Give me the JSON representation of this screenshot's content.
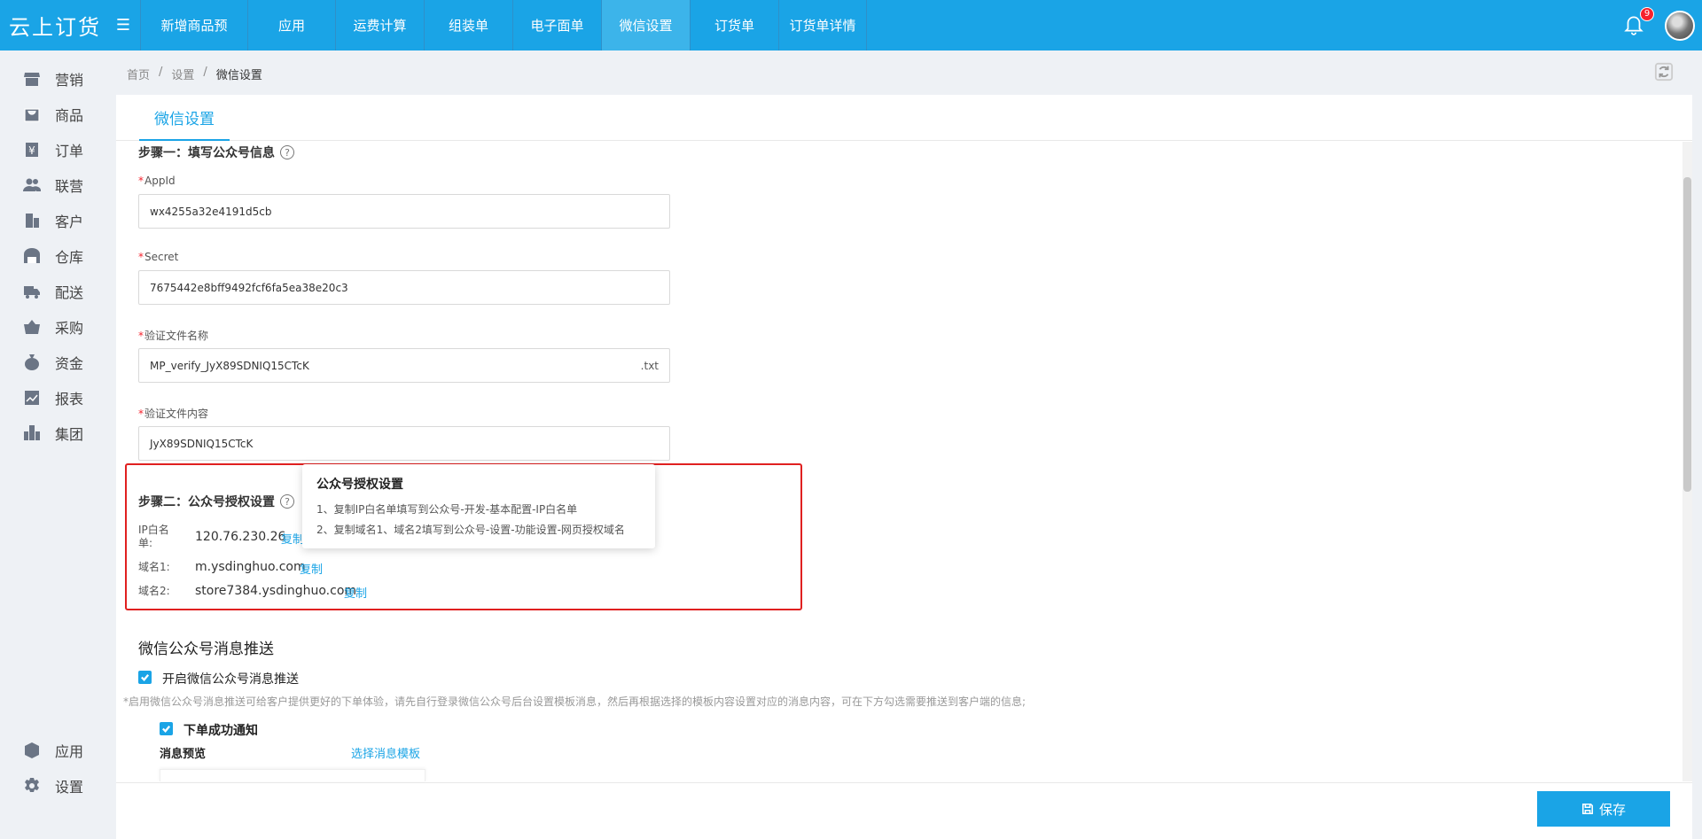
{
  "app": {
    "logo_text": "云上订货"
  },
  "nav": {
    "tabs": [
      {
        "label": "新增商品预"
      },
      {
        "label": "应用"
      },
      {
        "label": "运费计算"
      },
      {
        "label": "组装单"
      },
      {
        "label": "电子面单"
      },
      {
        "label": "微信设置",
        "active": true
      },
      {
        "label": "订货单"
      },
      {
        "label": "订货单详情"
      }
    ],
    "notifications": "9"
  },
  "sidebar": {
    "items": [
      {
        "label": "营销",
        "icon": "store-icon"
      },
      {
        "label": "商品",
        "icon": "bag-icon"
      },
      {
        "label": "订单",
        "icon": "yen-icon"
      },
      {
        "label": "联营",
        "icon": "people-icon"
      },
      {
        "label": "客户",
        "icon": "building-icon"
      },
      {
        "label": "仓库",
        "icon": "warehouse-icon"
      },
      {
        "label": "配送",
        "icon": "truck-icon"
      },
      {
        "label": "采购",
        "icon": "basket-icon"
      },
      {
        "label": "资金",
        "icon": "money-bag-icon"
      },
      {
        "label": "报表",
        "icon": "chart-icon"
      },
      {
        "label": "集团",
        "icon": "group-icon"
      }
    ],
    "bottom": [
      {
        "label": "应用",
        "icon": "cube-icon"
      },
      {
        "label": "设置",
        "icon": "gear-icon"
      }
    ]
  },
  "breadcrumb": {
    "home": "首页",
    "sep": "/",
    "level1": "设置",
    "current": "微信设置"
  },
  "page": {
    "tab": "微信设置",
    "step1": {
      "title": "步骤一：填写公众号信息",
      "fields": [
        {
          "label": "AppId",
          "value": "wx4255a32e4191d5cb"
        },
        {
          "label": "Secret",
          "value": "7675442e8bff9492fcf6fa5ea38e20c3"
        },
        {
          "label": "验证文件名称",
          "value": "MP_verify_JyX89SDNIQ15CTcK",
          "suffix": ".txt"
        },
        {
          "label": "验证文件内容",
          "value": "JyX89SDNIQ15CTcK"
        }
      ],
      "required_mark": "*"
    },
    "step2": {
      "title": "步骤二：公众号授权设置",
      "ip_label": "IP白名单:",
      "ip_value": "120.76.230.26",
      "domain1_label": "域名1:",
      "domain1_value": "m.ysdinghuo.com",
      "domain2_label": "域名2:",
      "domain2_value": "store7384.ysdinghuo.com",
      "copy_label": "复制"
    },
    "tooltip": {
      "title": "公众号授权设置",
      "line1": "1、复制IP白名单填写到公众号-开发-基本配置-IP白名单",
      "line2": "2、复制域名1、域名2填写到公众号-设置-功能设置-网页授权域名"
    },
    "push": {
      "title": "微信公众号消息推送",
      "enable_label": "开启微信公众号消息推送",
      "hint": "*启用微信公众号消息推送可给客户提供更好的下单体验，请先自行登录微信公众号后台设置模板消息，然后再根据选择的模板内容设置对应的消息内容，可在下方勾选需要推送到客户端的信息;",
      "order_success_label": "下单成功通知",
      "preview_label": "消息预览",
      "select_template": "选择消息模板"
    },
    "save_label": "保存"
  },
  "colors": {
    "primary": "#1aa4e6",
    "highlight_box": "#e02020"
  }
}
